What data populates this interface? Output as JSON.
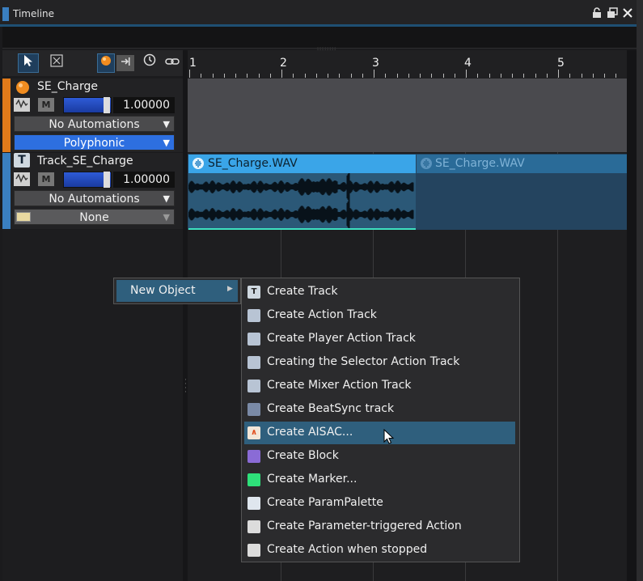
{
  "window": {
    "title": "Timeline",
    "controls": [
      "lock-icon",
      "restore-icon",
      "close-icon"
    ]
  },
  "toolbar": {
    "tools": [
      "select-arrow-icon",
      "cut-tool-icon",
      "record-sphere-icon",
      "export-arrow-icon",
      "clock-icon",
      "link-icon"
    ]
  },
  "ruler": {
    "bars": [
      "1",
      "2",
      "3",
      "4",
      "5"
    ]
  },
  "tracks": [
    {
      "name": "SE_Charge",
      "icon": "cue-sphere-icon",
      "volume": "1.00000",
      "mute_label": "M",
      "automation": "No Automations",
      "mode": "Polyphonic"
    },
    {
      "name": "Track_SE_Charge",
      "icon": "track-t-icon",
      "volume": "1.00000",
      "mute_label": "M",
      "automation": "No Automations",
      "selector": "None"
    }
  ],
  "clips": [
    {
      "label": "SE_Charge.WAV",
      "state": "selected"
    },
    {
      "label": "SE_Charge.WAV",
      "state": "ghost"
    }
  ],
  "context_menu": {
    "parent_item": "New Object",
    "items": [
      {
        "label": "Create Track",
        "icon": "track-t-icon"
      },
      {
        "label": "Create Action Track",
        "icon": "action-track-icon"
      },
      {
        "label": "Create Player Action Track",
        "icon": "player-action-icon"
      },
      {
        "label": "Creating the Selector Action Track",
        "icon": "selector-action-icon"
      },
      {
        "label": "Create Mixer Action Track",
        "icon": "mixer-action-icon"
      },
      {
        "label": "Create BeatSync track",
        "icon": "beatsync-icon"
      },
      {
        "label": "Create AISAC...",
        "icon": "aisac-icon",
        "highlighted": true
      },
      {
        "label": "Create Block",
        "icon": "block-icon"
      },
      {
        "label": "Create Marker...",
        "icon": "marker-flag-icon"
      },
      {
        "label": "Create ParamPalette",
        "icon": "param-palette-icon"
      },
      {
        "label": "Create Parameter-triggered Action",
        "icon": "clapper-icon"
      },
      {
        "label": "Create Action when stopped",
        "icon": "clapper-stop-icon"
      }
    ]
  },
  "colors": {
    "accent_blue": "#3aa5e8",
    "menu_highlight": "#2f5f7d",
    "polyphonic_blue": "#2d6fe0",
    "cue_orange": "#e07a1a"
  }
}
